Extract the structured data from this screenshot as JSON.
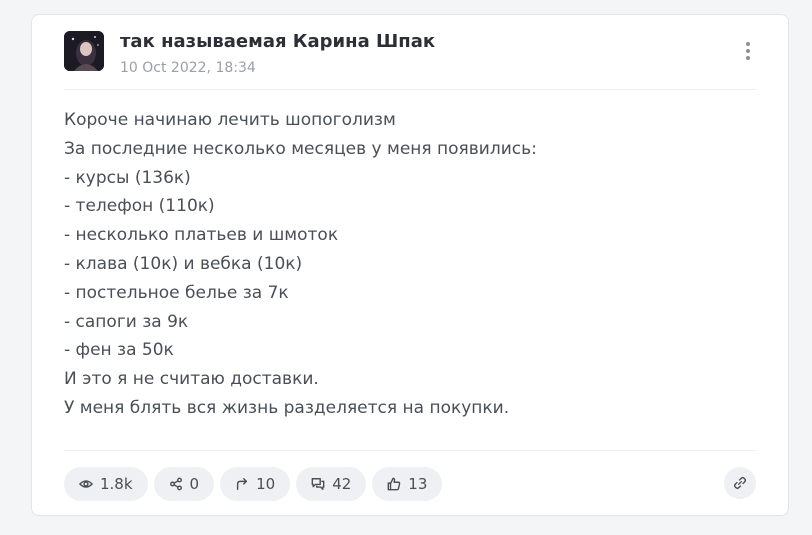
{
  "post": {
    "author": "так называемая Карина Шпак",
    "date": "10 Oct 2022, 18:34",
    "lines": [
      "Короче начинаю лечить шопоголизм",
      "За последние несколько месяцев у меня появились:",
      "- курсы (136к)",
      "- телефон (110к)",
      "- несколько платьев и шмоток",
      "- клава (10к) и вебка (10к)",
      "- постельное белье за 7к",
      "- сапоги за 9к",
      "- фен за 50к",
      "И это я не считаю доставки.",
      "У меня блять вся жизнь разделяется на покупки."
    ]
  },
  "stats": {
    "views": "1.8k",
    "shares": "0",
    "reposts": "10",
    "comments": "42",
    "likes": "13"
  },
  "icons": {
    "views": "eye-icon",
    "shares": "share-nodes-icon",
    "reposts": "forward-arrow-icon",
    "comments": "comments-icon",
    "likes": "thumbs-up-icon",
    "menu": "more-vertical-icon",
    "link": "link-icon"
  },
  "colors": {
    "background": "#f4f5f7",
    "card": "#ffffff",
    "pill": "#eef0f3",
    "text": "#4a4f57",
    "muted": "#9aa0a8"
  }
}
